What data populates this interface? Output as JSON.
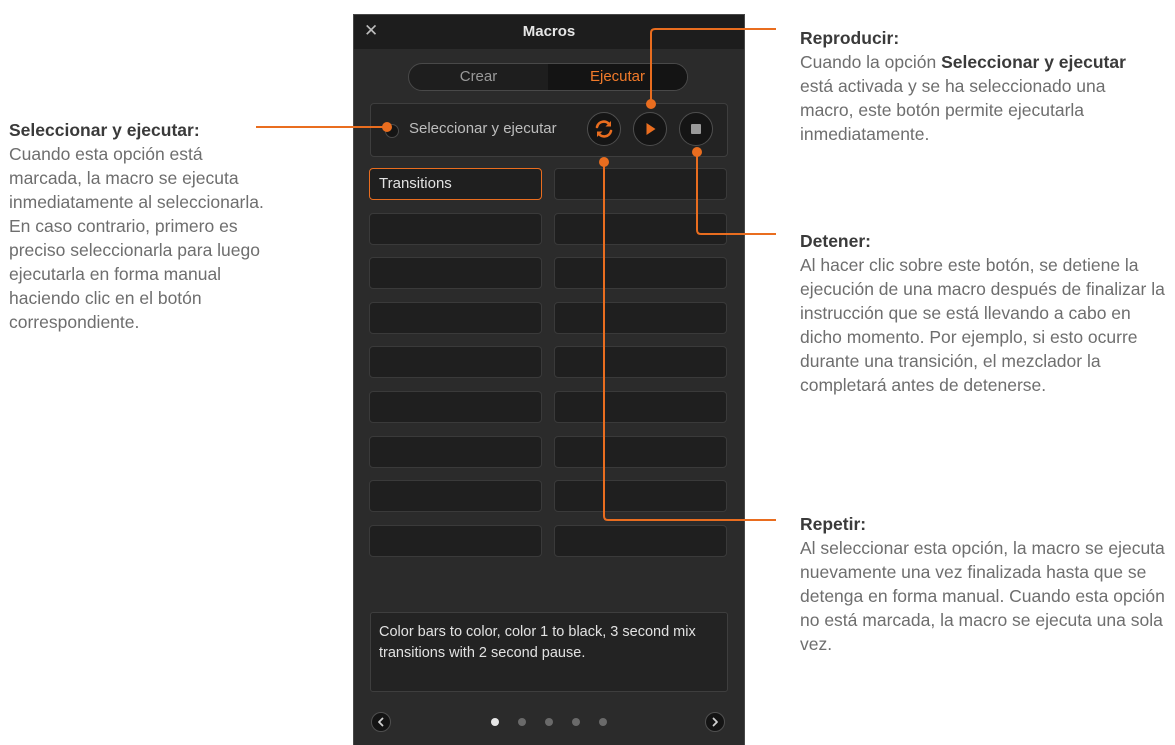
{
  "annotations": {
    "select_run": {
      "title": "Seleccionar y ejecutar:",
      "text": "Cuando esta opción está marcada, la macro se ejecuta inmediatamente al seleccionarla. En caso contrario, primero es preciso seleccionarla para luego ejecutarla en forma manual haciendo clic en el botón correspondiente."
    },
    "play": {
      "title": "Reproducir:",
      "text_before": "Cuando la opción ",
      "bold": "Seleccionar y ejecutar",
      "text_after": " está activada y se ha seleccionado una macro, este botón permite ejecutarla inmediatamente."
    },
    "stop": {
      "title": "Detener:",
      "text": "Al hacer clic sobre este botón, se detiene la ejecución de una macro después de finalizar la instrucción que se está llevando a cabo en dicho momento. Por ejemplo, si esto ocurre durante una transición, el mezclador la completará antes de detenerse."
    },
    "loop": {
      "title": "Repetir:",
      "text": "Al seleccionar esta opción, la macro se ejecuta nuevamente una vez finalizada hasta que se detenga en forma manual. Cuando esta opción no está marcada, la macro se ejecuta una sola vez."
    }
  },
  "panel": {
    "title": "Macros",
    "close_icon": "close-icon",
    "tabs": [
      {
        "label": "Crear",
        "active": false
      },
      {
        "label": "Ejecutar",
        "active": true
      }
    ],
    "select_run_label": "Seleccionar y ejecutar",
    "select_run_checked": false,
    "buttons": [
      "loop-icon",
      "play-icon",
      "stop-icon"
    ],
    "macros": [
      "Transitions",
      "",
      "",
      "",
      "",
      "",
      "",
      "",
      "",
      "",
      "",
      "",
      "",
      "",
      "",
      "",
      "",
      ""
    ],
    "selected_macro": 0,
    "description": "Color bars to color, color 1 to black, 3 second mix transitions with 2 second pause.",
    "pages": 5,
    "current_page": 1
  },
  "colors": {
    "accent": "#e96d1f",
    "panel_bg": "#2b2b2b",
    "titlebar_bg": "#1d1d1d"
  }
}
